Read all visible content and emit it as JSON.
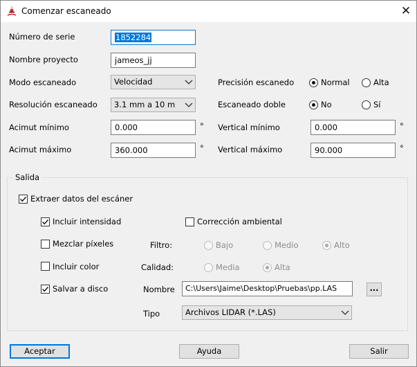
{
  "window": {
    "title": "Comenzar escaneado",
    "close_glyph": "✕"
  },
  "labels": {
    "serie": "Número de serie",
    "proyecto": "Nombre proyecto",
    "modo": "Modo escaneado",
    "resolucion": "Resolución escaneado",
    "acimut_min": "Acimut mínimo",
    "acimut_max": "Acimut máximo",
    "precision": "Precisión escanedo",
    "doble": "Escaneado doble",
    "vertical_min": "Vertical mínimo",
    "vertical_max": "Vertical máximo",
    "degree": "°"
  },
  "fields": {
    "serie": "1852284",
    "proyecto": "jameos_jj",
    "modo": "Velocidad",
    "resolucion": "3.1 mm a 10 m",
    "acimut_min": "0.000",
    "acimut_max": "360.000",
    "vertical_min": "0.000",
    "vertical_max": "90.000"
  },
  "precision": {
    "normal": "Normal",
    "alta": "Alta",
    "selected": "Normal"
  },
  "doble": {
    "no": "No",
    "si": "Sí",
    "selected": "No"
  },
  "salida": {
    "legend": "Salida",
    "extraer": "Extraer datos del escáner",
    "intensidad": "Incluir intensidad",
    "correccion": "Corrección ambiental",
    "mezclar": "Mezclar píxeles",
    "color": "Incluir color",
    "salvar": "Salvar a disco",
    "filtro": "Filtro:",
    "calidad": "Calidad:",
    "bajo": "Bajo",
    "medio": "Medio",
    "alto": "Alto",
    "media": "Media",
    "alta": "Alta",
    "nombre_label": "Nombre",
    "nombre_value": "C:\\Users\\Jaime\\Desktop\\Pruebas\\pp.LAS",
    "browse": "...",
    "tipo_label": "Tipo",
    "tipo_value": "Archivos LIDAR (*.LAS)"
  },
  "buttons": {
    "aceptar": "Aceptar",
    "ayuda": "Ayuda",
    "salir": "Salir"
  },
  "colors": {
    "accent": "#0078d7",
    "face": "#f0f0f0"
  }
}
